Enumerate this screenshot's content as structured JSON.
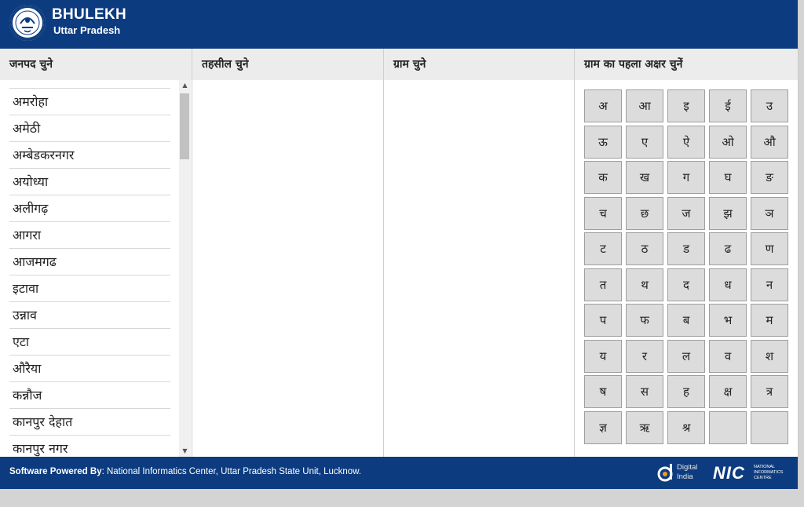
{
  "header": {
    "title": "BHULEKH",
    "subtitle": "Uttar Pradesh",
    "emblem_icon": "up-state-emblem-icon"
  },
  "columns": {
    "district": "जनपद चुने",
    "tehsil": "तहसील चुने",
    "village": "ग्राम चुने",
    "letter": "ग्राम का पहला अक्षर चुनें"
  },
  "districts": [
    "अमरोहा",
    "अमेठी",
    "अम्बेडकरनगर",
    "अयोध्या",
    "अलीगढ़",
    "आगरा",
    "आजमगढ",
    "इटावा",
    "उन्नाव",
    "एटा",
    "औरैया",
    "कन्नौज",
    "कानपुर देहात",
    "कानपुर नगर"
  ],
  "letters": [
    "अ",
    "आ",
    "इ",
    "ई",
    "उ",
    "ऊ",
    "ए",
    "ऐ",
    "ओ",
    "औ",
    "क",
    "ख",
    "ग",
    "घ",
    "ङ",
    "च",
    "छ",
    "ज",
    "झ",
    "ञ",
    "ट",
    "ठ",
    "ड",
    "ढ",
    "ण",
    "त",
    "थ",
    "द",
    "ध",
    "न",
    "प",
    "फ",
    "ब",
    "भ",
    "म",
    "य",
    "र",
    "ल",
    "व",
    "श",
    "ष",
    "स",
    "ह",
    "क्ष",
    "त्र",
    "ज्ञ",
    "ऋ",
    "श्र",
    "",
    ""
  ],
  "footer": {
    "label": "Software Powered By",
    "text": ": National Informatics Center, Uttar Pradesh State Unit, Lucknow.",
    "digital_india_line1": "Digital",
    "digital_india_line2": "India",
    "nic_short": "NIC",
    "nic_full_line1": "NATIONAL",
    "nic_full_line2": "INFORMATICS",
    "nic_full_line3": "CENTRE"
  },
  "colors": {
    "header_bg": "#0c3b7f",
    "button_bg": "#dcdcdc",
    "column_header_bg": "#ececec"
  }
}
